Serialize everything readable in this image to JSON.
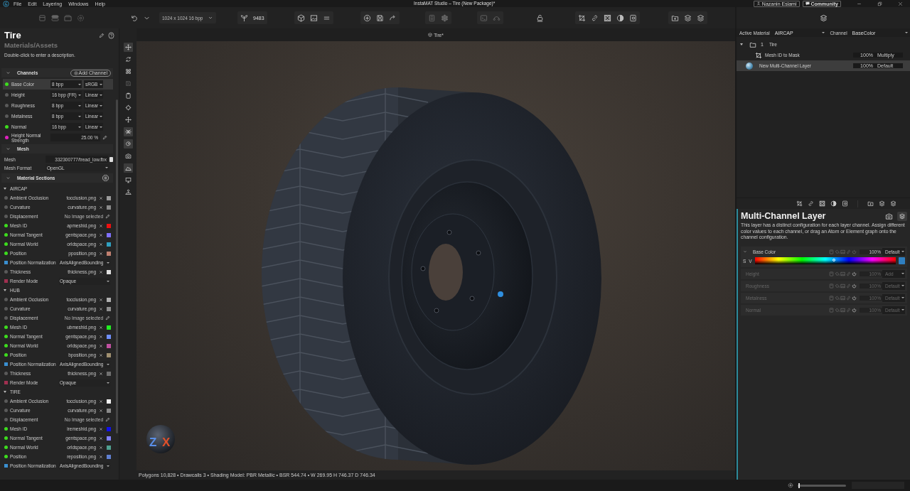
{
  "menu": [
    "File",
    "Edit",
    "Layering",
    "Windows",
    "Help"
  ],
  "window_title": "InstaMAT Studio  –  Tire (New Package)*",
  "account": {
    "user": "Nazanin Eslami",
    "community": "Community"
  },
  "toolbar": {
    "resolution": "1024 x 1024 16 bpp",
    "seed": "9483"
  },
  "asset": {
    "title": "Tire",
    "path": "Materials/Assets",
    "description": "Double-click to enter a description."
  },
  "channels": {
    "title": "Channels",
    "add_label": "Add Channel",
    "items": [
      {
        "name": "Base Color",
        "color": "#3ddc1e",
        "kind": "format",
        "bpp": "8 bpp",
        "space": "sRGB",
        "selected": true
      },
      {
        "name": "Height",
        "color": "#5a5a5a",
        "kind": "format",
        "bpp": "16 bpp (FR)",
        "space": "Linear",
        "selected": false
      },
      {
        "name": "Roughness",
        "color": "#5a5a5a",
        "kind": "format",
        "bpp": "8 bpp",
        "space": "Linear",
        "selected": false
      },
      {
        "name": "Metalness",
        "color": "#5a5a5a",
        "kind": "format",
        "bpp": "8 bpp",
        "space": "Linear",
        "selected": false
      },
      {
        "name": "Normal",
        "color": "#3ddc1e",
        "kind": "format",
        "bpp": "16 bpp",
        "space": "Linear",
        "selected": false
      },
      {
        "name": "Height Normal Strength",
        "color": "#e020c0",
        "kind": "value",
        "value": "25.00 %",
        "selected": false
      }
    ]
  },
  "mesh": {
    "title": "Mesh",
    "file_label": "Mesh",
    "file": "332300777/tread_low.fbx",
    "format_label": "Mesh Format",
    "format": "OpenGL"
  },
  "material_sections": {
    "title": "Material Sections",
    "groups": [
      {
        "name": "AIRCAP",
        "expanded": true,
        "rows": [
          {
            "label": "Ambient Occlusion",
            "kind": "file",
            "color": "#5a5a5a",
            "value": "tocclusion.png",
            "thumbnail": {
              "color": "#9a9a9a"
            }
          },
          {
            "label": "Curvature",
            "kind": "file",
            "color": "#5a5a5a",
            "value": "curvature.png",
            "thumbnail": {
              "color": "#8a8a8a"
            }
          },
          {
            "label": "Displacement",
            "kind": "none",
            "color": "#5a5a5a",
            "value": "No Image selected"
          },
          {
            "label": "Mesh ID",
            "kind": "file",
            "color": "#3ddc1e",
            "value": "apmeshid.png",
            "thumbnail": {
              "color": "#ee1010"
            }
          },
          {
            "label": "Normal Tangent",
            "kind": "file",
            "color": "#3ddc1e",
            "value": "gentspace.png",
            "thumbnail": {
              "color": "#8070ff"
            }
          },
          {
            "label": "Normal World",
            "kind": "file",
            "color": "#3ddc1e",
            "value": "orldspace.png",
            "thumbnail": {
              "color": "#30a0c0"
            }
          },
          {
            "label": "Position",
            "kind": "file",
            "color": "#3ddc1e",
            "value": "pposition.png",
            "thumbnail": {
              "color": "#c08070"
            }
          },
          {
            "label": "Position Normalization",
            "kind": "select",
            "color": "#3a8fd0",
            "value": "AxisAlignedBounding"
          },
          {
            "label": "Thickness",
            "kind": "file",
            "color": "#5a5a5a",
            "value": "thickness.png",
            "thumbnail": {
              "color": "#e0e0e0"
            }
          },
          {
            "label": "Render Mode",
            "kind": "select",
            "color": "#a03050",
            "value": "Opaque"
          }
        ]
      },
      {
        "name": "HUB",
        "expanded": true,
        "rows": [
          {
            "label": "Ambient Occlusion",
            "kind": "file",
            "color": "#5a5a5a",
            "value": "tocclusion.png",
            "thumbnail": {
              "color": "#b0b0b0"
            }
          },
          {
            "label": "Curvature",
            "kind": "file",
            "color": "#5a5a5a",
            "value": "curvature.png",
            "thumbnail": {
              "color": "#909090"
            }
          },
          {
            "label": "Displacement",
            "kind": "none",
            "color": "#5a5a5a",
            "value": "No Image selected"
          },
          {
            "label": "Mesh ID",
            "kind": "file",
            "color": "#3ddc1e",
            "value": "ubmeshid.png",
            "thumbnail": {
              "color": "#22ee22"
            }
          },
          {
            "label": "Normal Tangent",
            "kind": "file",
            "color": "#3ddc1e",
            "value": "gentspace.png",
            "thumbnail": {
              "color": "#7090ff"
            }
          },
          {
            "label": "Normal World",
            "kind": "file",
            "color": "#3ddc1e",
            "value": "orldspace.png",
            "thumbnail": {
              "color": "#c050a0"
            }
          },
          {
            "label": "Position",
            "kind": "file",
            "color": "#3ddc1e",
            "value": "bposition.png",
            "thumbnail": {
              "color": "#a09070"
            }
          },
          {
            "label": "Position Normalization",
            "kind": "select",
            "color": "#3a8fd0",
            "value": "AxisAlignedBounding"
          },
          {
            "label": "Thickness",
            "kind": "file",
            "color": "#5a5a5a",
            "value": "thickness.png",
            "thumbnail": {
              "color": "#707070"
            }
          },
          {
            "label": "Render Mode",
            "kind": "select",
            "color": "#a03050",
            "value": "Opaque"
          }
        ]
      },
      {
        "name": "TIRE",
        "expanded": true,
        "rows": [
          {
            "label": "Ambient Occlusion",
            "kind": "file",
            "color": "#5a5a5a",
            "value": "tocclusion.png",
            "thumbnail": {
              "color": "#f0f0f0"
            }
          },
          {
            "label": "Curvature",
            "kind": "file",
            "color": "#5a5a5a",
            "value": "curvature.png",
            "thumbnail": {
              "color": "#8a8a8a"
            }
          },
          {
            "label": "Displacement",
            "kind": "none",
            "color": "#5a5a5a",
            "value": "No Image selected"
          },
          {
            "label": "Mesh ID",
            "kind": "file",
            "color": "#3ddc1e",
            "value": "iremeshid.png",
            "thumbnail": {
              "color": "#1010ee"
            }
          },
          {
            "label": "Normal Tangent",
            "kind": "file",
            "color": "#3ddc1e",
            "value": "gentspace.png",
            "thumbnail": {
              "color": "#8080ff"
            }
          },
          {
            "label": "Normal World",
            "kind": "file",
            "color": "#3ddc1e",
            "value": "orldspace.png",
            "thumbnail": {
              "color": "#50a090"
            }
          },
          {
            "label": "Position",
            "kind": "file",
            "color": "#3ddc1e",
            "value": "reposition.png",
            "thumbnail": {
              "color": "#6080d0"
            }
          },
          {
            "label": "Position Normalization",
            "kind": "select",
            "color": "#3a8fd0",
            "value": "AxisAlignedBounding"
          }
        ]
      }
    ]
  },
  "tools": [
    {
      "selected": true,
      "disabled": false
    },
    {
      "selected": false,
      "disabled": false
    },
    {
      "selected": false,
      "disabled": false
    },
    {
      "selected": false,
      "disabled": true
    },
    {
      "selected": false,
      "disabled": false
    },
    {
      "selected": false,
      "disabled": false
    },
    {
      "selected": false,
      "disabled": false
    },
    {
      "selected": true,
      "disabled": false
    },
    {
      "selected": true,
      "disabled": false
    },
    {
      "selected": false,
      "disabled": false
    },
    {
      "selected": true,
      "disabled": false
    },
    {
      "selected": false,
      "disabled": false
    },
    {
      "selected": false,
      "disabled": false
    }
  ],
  "viewport": {
    "tab": "Tire*",
    "gizmo_labels": [
      "Z",
      "X"
    ],
    "status": "Polygons 10,828 • Drawcalls 3 • Shading Model: PBR Metallic • BSR 544.74 • W 269.95 H 746.37 D 746.34"
  },
  "layers_panel": {
    "active_material_label": "Active Material",
    "active_material": "AIRCAP",
    "channel_label": "Channel",
    "channel": "BaseColor",
    "layers": [
      {
        "name": "Tire",
        "kind": "folder",
        "badge": "1",
        "expanded": true,
        "selected": false,
        "children": [
          {
            "name": "Mesh ID to Mask",
            "kind": "mask",
            "opacity": "100%",
            "blend": "Multiply",
            "selected": false
          }
        ]
      },
      {
        "name": "New Multi-Channel Layer",
        "kind": "layer",
        "opacity": "100%",
        "blend": "Default",
        "selected": true
      }
    ]
  },
  "properties": {
    "title": "Multi-Channel Layer",
    "description": "This layer has a distinct configuration for each layer channel. Assign different color values to each channel, or drag an Atom or Element graph onto the channel configuration.",
    "channels": [
      {
        "name": "Base Color",
        "enabled": true,
        "expanded": true,
        "opacity": "100%",
        "blend": "Default",
        "slider_labels": [
          "S",
          "V"
        ],
        "level": 0.56,
        "swatch": {
          "color": "#2f7fc0"
        }
      },
      {
        "name": "Height",
        "enabled": false,
        "expanded": false,
        "opacity": "100%",
        "blend": "Add"
      },
      {
        "name": "Roughness",
        "enabled": false,
        "expanded": false,
        "opacity": "100%",
        "blend": "Default"
      },
      {
        "name": "Metalness",
        "enabled": false,
        "expanded": false,
        "opacity": "100%",
        "blend": "Default"
      },
      {
        "name": "Normal",
        "enabled": false,
        "expanded": false,
        "opacity": "100%",
        "blend": "Default"
      }
    ]
  },
  "zoom": {
    "level": 0.02
  }
}
